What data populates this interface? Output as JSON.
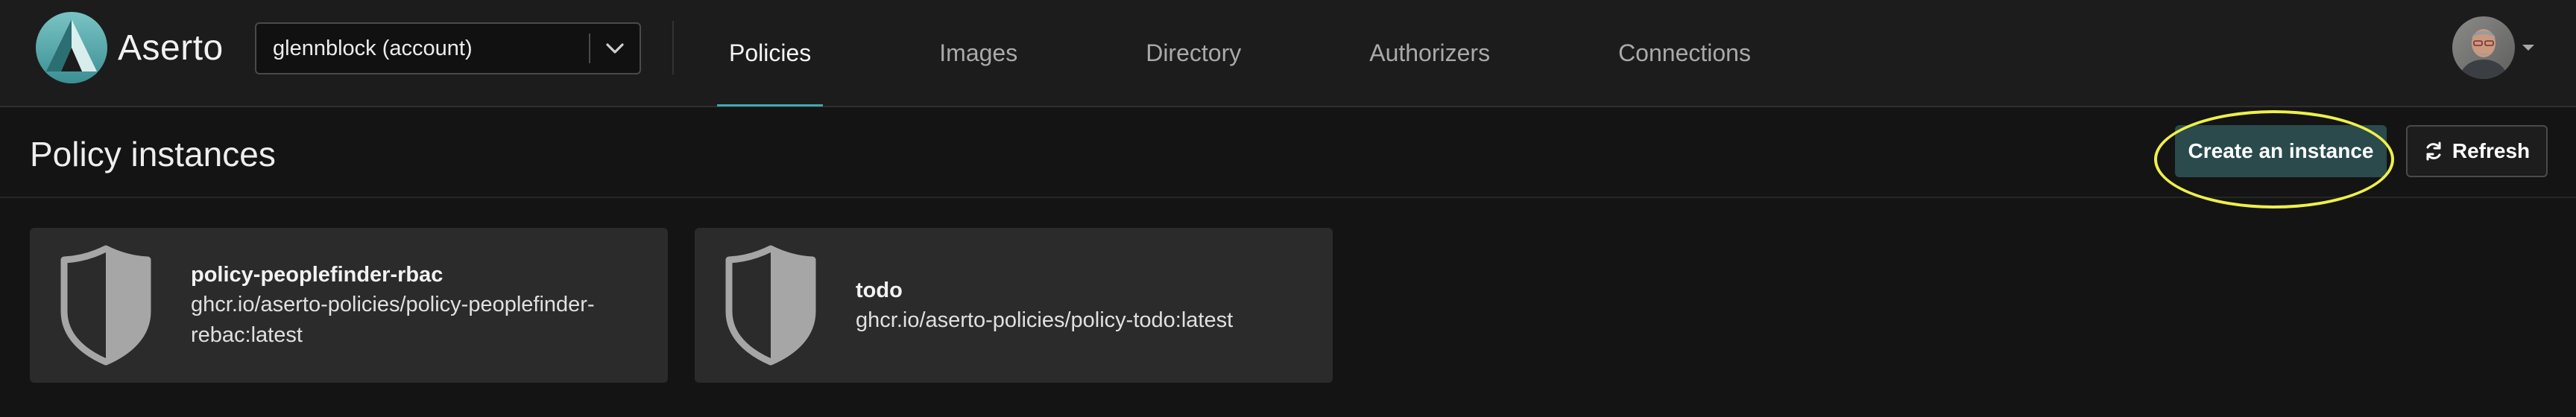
{
  "app": {
    "brand": "Aserto",
    "account": "glennblock (account)"
  },
  "nav": {
    "tabs": [
      {
        "label": "Policies",
        "active": true
      },
      {
        "label": "Images",
        "active": false
      },
      {
        "label": "Directory",
        "active": false
      },
      {
        "label": "Authorizers",
        "active": false
      },
      {
        "label": "Connections",
        "active": false
      }
    ]
  },
  "page": {
    "title": "Policy instances",
    "create_label": "Create an instance",
    "refresh_label": "Refresh"
  },
  "instances": [
    {
      "name": "policy-peoplefinder-rbac",
      "image": "ghcr.io/aserto-policies/policy-peoplefinder-rebac:latest"
    },
    {
      "name": "todo",
      "image": "ghcr.io/aserto-policies/policy-todo:latest"
    }
  ],
  "colors": {
    "accent": "#3fa9b0",
    "primary_button": "#2a4a4c",
    "highlight": "#eef04a",
    "card": "#2b2b2b"
  },
  "icons": {
    "brand": "aserto-logo-icon",
    "select_caret": "chevron-down-icon",
    "user_menu": "caret-down-icon",
    "refresh": "refresh-icon",
    "instance": "shield-icon"
  }
}
